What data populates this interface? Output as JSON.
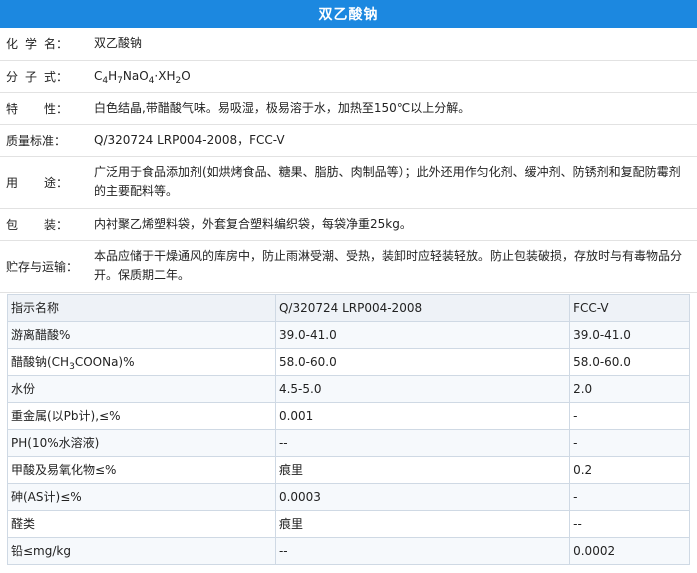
{
  "title": "双乙酸钠",
  "props": {
    "chem_name": {
      "label": [
        "化",
        "学",
        "名："
      ],
      "value": "双乙酸钠"
    },
    "formula": {
      "label": [
        "分",
        "子",
        "式："
      ],
      "p1": "C",
      "s1": "4",
      "p2": "H",
      "s2": "7",
      "p3": "NaO",
      "s3": "4",
      "p4": "·XH",
      "s4": "2",
      "p5": "O"
    },
    "property": {
      "label": [
        "特",
        "性："
      ],
      "value": "白色结晶,带醋酸气味。易吸湿，极易溶于水，加热至150℃以上分解。"
    },
    "standard": {
      "label": [
        "质量标准："
      ],
      "value": "Q/320724 LRP004-2008，FCC-V"
    },
    "usage": {
      "label": [
        "用",
        "途："
      ],
      "value": "广泛用于食品添加剂(如烘烤食品、糖果、脂肪、肉制品等）；此外还用作匀化剂、缓冲剂、防锈剂和复配防霉剂的主要配料等。"
    },
    "packaging": {
      "label": [
        "包",
        "装："
      ],
      "value": "内衬聚乙烯塑料袋，外套复合塑料编织袋，每袋净重25kg。"
    },
    "storage": {
      "label": [
        "贮存与运输："
      ],
      "value": "本品应储于干燥通风的库房中，防止雨淋受潮、受热，装卸时应轻装轻放。防止包装破损，存放时与有毒物品分开。保质期二年。"
    }
  },
  "spec_table": {
    "headers": [
      "指示名称",
      "Q/320724 LRP004-2008",
      "FCC-V"
    ],
    "rows": [
      [
        "游离醋酸%",
        "39.0-41.0",
        "39.0-41.0"
      ],
      [
        "醋酸钠(CH3COONa)%",
        "58.0-60.0",
        "58.0-60.0"
      ],
      [
        "水份",
        "4.5-5.0",
        "2.0"
      ],
      [
        "重金属(以Pb计),≤%",
        "0.001",
        "-"
      ],
      [
        "PH(10%水溶液)",
        "--",
        "-"
      ],
      [
        "甲酸及易氧化物≤%",
        "痕里",
        "0.2"
      ],
      [
        "砷(AS计)≤%",
        "0.0003",
        "-"
      ],
      [
        "醛类",
        "痕里",
        "--"
      ],
      [
        "铅≤mg/kg",
        "--",
        "0.0002"
      ]
    ],
    "sodium_acetate": {
      "pre": "醋酸钠(CH",
      "sub": "3",
      "post": "COONa)%"
    }
  }
}
